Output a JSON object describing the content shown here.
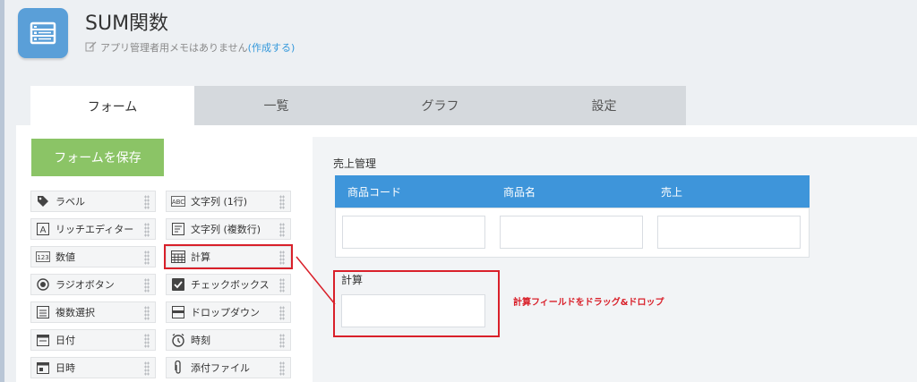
{
  "app": {
    "title": "SUM関数",
    "memo_text": "アプリ管理者用メモはありません",
    "memo_link": "(作成する)",
    "icon": "list-icon",
    "accent": "#5a9fd8"
  },
  "tabs": [
    {
      "label": "フォーム",
      "active": true
    },
    {
      "label": "一覧",
      "active": false
    },
    {
      "label": "グラフ",
      "active": false
    },
    {
      "label": "設定",
      "active": false
    }
  ],
  "save_button": {
    "label": "フォームを保存",
    "color": "#8bc466"
  },
  "palette": {
    "left": [
      {
        "label": "ラベル",
        "icon": "tag-icon"
      },
      {
        "label": "リッチエディター",
        "icon": "rich-editor-icon"
      },
      {
        "label": "数値",
        "icon": "number-icon"
      },
      {
        "label": "ラジオボタン",
        "icon": "radio-icon"
      },
      {
        "label": "複数選択",
        "icon": "multi-select-icon"
      },
      {
        "label": "日付",
        "icon": "date-icon"
      },
      {
        "label": "日時",
        "icon": "datetime-icon"
      }
    ],
    "right": [
      {
        "label": "文字列 (1行)",
        "icon": "text-single-icon"
      },
      {
        "label": "文字列 (複数行)",
        "icon": "text-multi-icon"
      },
      {
        "label": "計算",
        "icon": "calculator-icon",
        "highlighted": true
      },
      {
        "label": "チェックボックス",
        "icon": "checkbox-icon"
      },
      {
        "label": "ドロップダウン",
        "icon": "dropdown-icon"
      },
      {
        "label": "時刻",
        "icon": "clock-icon"
      },
      {
        "label": "添付ファイル",
        "icon": "paperclip-icon"
      }
    ]
  },
  "form": {
    "table_label": "売上管理",
    "table_columns": [
      "商品コード",
      "商品名",
      "売上"
    ],
    "table_header_color": "#3e95da",
    "calc_field_label": "計算",
    "hint": "計算フィールドをドラッグ&ドロップ",
    "hint_color": "#d9202a"
  }
}
